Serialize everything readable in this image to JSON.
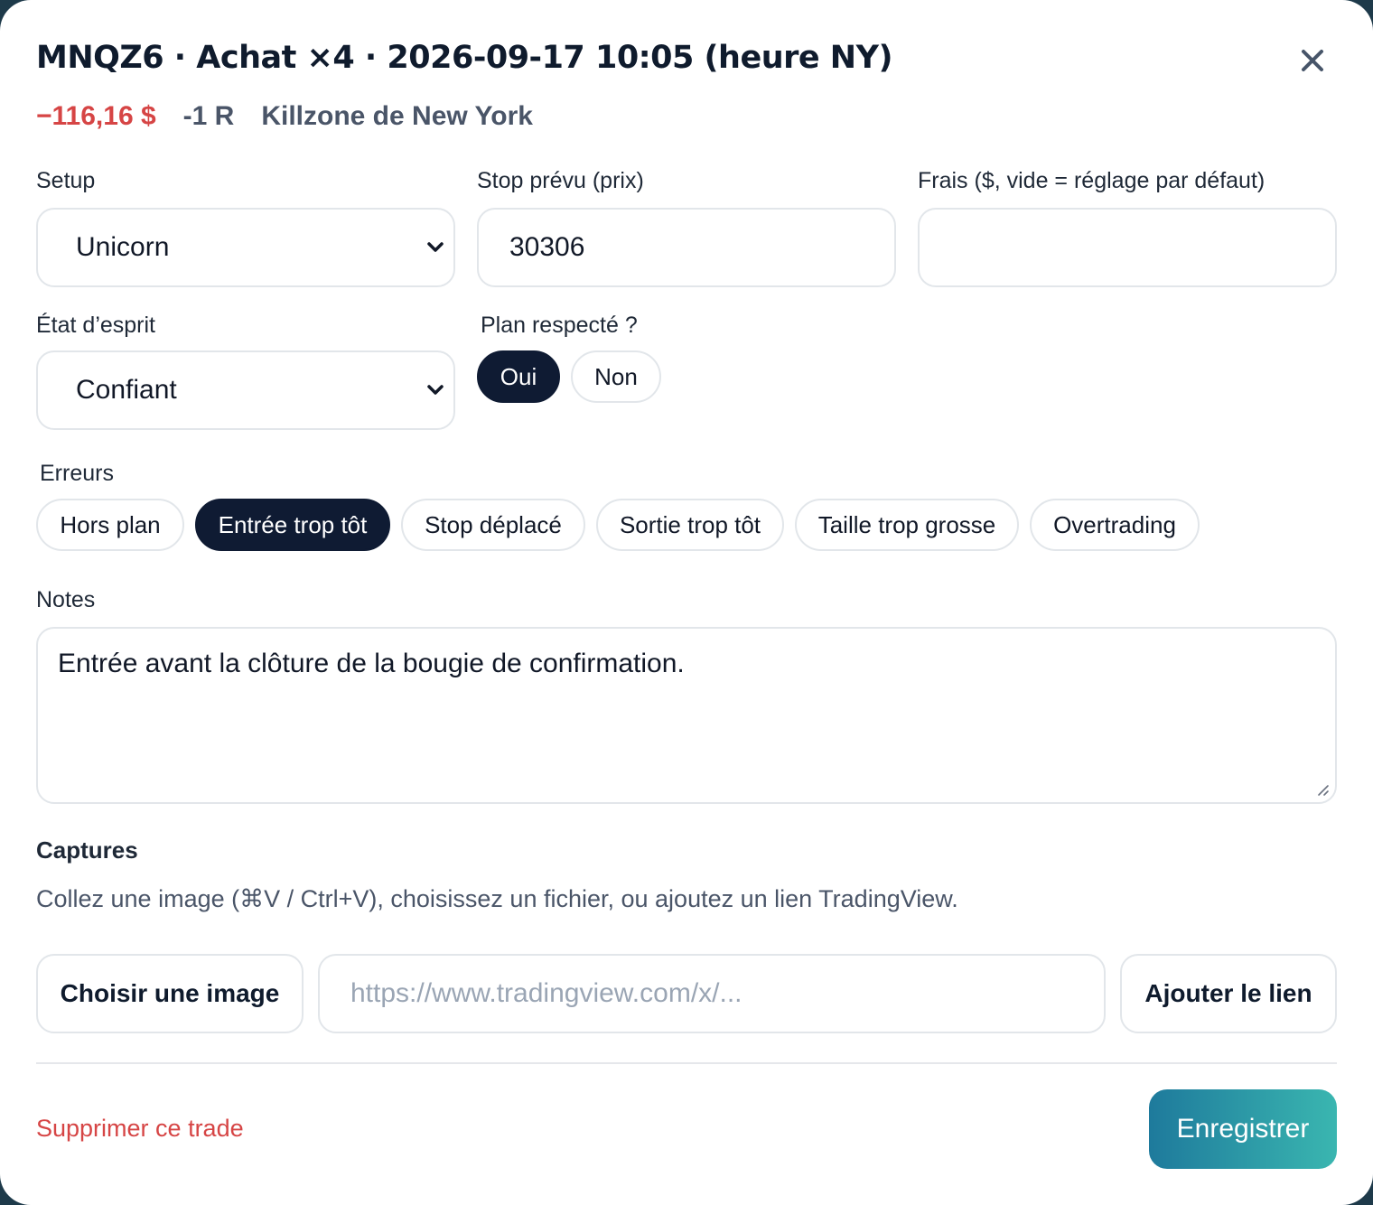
{
  "header": {
    "title": "MNQZ6 · Achat ×4 · 2026-09-17 10:05 (heure NY)",
    "pnl": "−116,16 $",
    "r_multiple": "-1 R",
    "session": "Killzone de New York"
  },
  "fields": {
    "setup": {
      "label": "Setup",
      "value": "Unicorn"
    },
    "stop": {
      "label": "Stop prévu (prix)",
      "value": "30306"
    },
    "fees": {
      "label": "Frais ($, vide = réglage par défaut)",
      "value": ""
    },
    "mindset": {
      "label": "État d’esprit",
      "value": "Confiant"
    }
  },
  "plan": {
    "label": "Plan respecté ?",
    "yes": "Oui",
    "no": "Non",
    "selected": "Oui"
  },
  "errors": {
    "label": "Erreurs",
    "items": [
      {
        "label": "Hors plan",
        "active": false
      },
      {
        "label": "Entrée trop tôt",
        "active": true
      },
      {
        "label": "Stop déplacé",
        "active": false
      },
      {
        "label": "Sortie trop tôt",
        "active": false
      },
      {
        "label": "Taille trop grosse",
        "active": false
      },
      {
        "label": "Overtrading",
        "active": false
      }
    ]
  },
  "notes": {
    "label": "Notes",
    "value": "Entrée avant la clôture de la bougie de confirmation."
  },
  "captures": {
    "title": "Captures",
    "help": "Collez une image (⌘V / Ctrl+V), choisissez un fichier, ou ajoutez un lien TradingView.",
    "choose_label": "Choisir une image",
    "url_placeholder": "https://www.tradingview.com/x/...",
    "add_link_label": "Ajouter le lien"
  },
  "footer": {
    "delete_label": "Supprimer ce trade",
    "save_label": "Enregistrer"
  },
  "colors": {
    "accent_dark": "#0f1b33",
    "danger": "#d64545",
    "save_gradient_start": "#1e7a9c",
    "save_gradient_end": "#3ab6b0"
  },
  "icons": {
    "close": "close-icon",
    "dropdown": "chevron-down-icon",
    "resize": "resize-handle-icon"
  }
}
